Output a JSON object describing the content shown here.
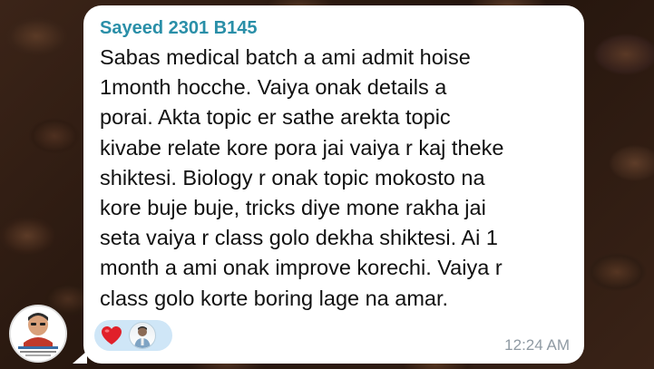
{
  "chat": {
    "sender_name": "Sayeed 2301 B145",
    "message_text": "Sabas medical batch a ami admit hoise\n1month hocche. Vaiya onak details a\nporai. Akta topic er sathe  arekta topic\nkivabe relate kore pora jai vaiya r kaj theke\nshiktesi. Biology r onak topic mokosto na\nkore buje buje, tricks diye mone rakha jai\nseta vaiya r class golo dekha shiktesi. Ai 1\nmonth a ami onak improve korechi. Vaiya r\nclass golo korte boring lage na amar.",
    "timestamp": "12:24 AM",
    "reactions": [
      {
        "emoji_name": "heart-icon",
        "color": "#e0202a"
      },
      {
        "emoji_name": "reactor-avatar"
      }
    ]
  },
  "colors": {
    "sender": "#2a8fa8",
    "bubble": "#ffffff",
    "reaction_pill": "#cfe6f7",
    "timestamp": "#8f9aa3"
  }
}
